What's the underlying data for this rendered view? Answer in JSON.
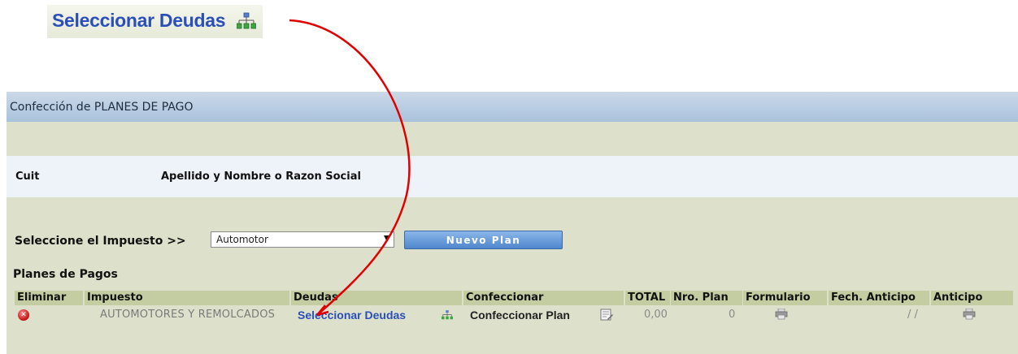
{
  "callout": {
    "label": "Seleccionar Deudas",
    "icon": "org-chart-icon"
  },
  "panel": {
    "title": "Confección de PLANES DE PAGO",
    "cuit_label": "Cuit",
    "name_label": "Apellido y Nombre o Razon Social",
    "tax_prompt": "Seleccione el Impuesto >>",
    "tax_select_value": "Automotor",
    "new_plan_button": "Nuevo Plan",
    "plans_title": "Planes de Pagos"
  },
  "table": {
    "columns": [
      "Eliminar",
      "Impuesto",
      "Deudas",
      "Confeccionar",
      "TOTAL",
      "Nro. Plan",
      "Formulario",
      "Fech. Anticipo",
      "Anticipo"
    ],
    "rows": [
      {
        "impuesto": "AUTOMOTORES Y REMOLCADOS",
        "deudas": "Seleccionar Deudas",
        "confeccionar": "Confeccionar Plan",
        "total": "0,00",
        "nro_plan": "0",
        "fech_anticipo": "/ /"
      }
    ]
  },
  "colors": {
    "link_blue": "#2b4fb8",
    "panel_bg": "#dde1cb",
    "header_bg": "#a9c2dc",
    "column_header_bg": "#c4cca2",
    "annotation_red": "#e00000"
  }
}
